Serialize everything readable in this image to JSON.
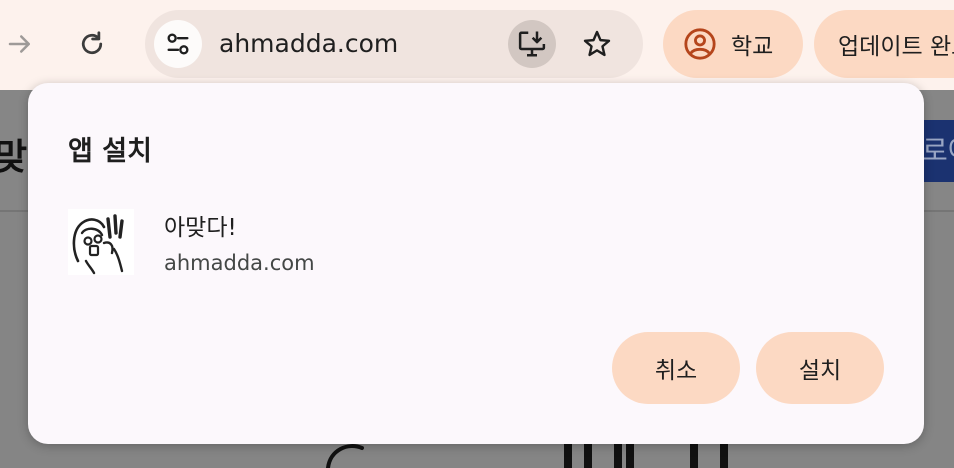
{
  "toolbar": {
    "url": "ahmadda.com",
    "profile_label": "학교",
    "update_label": "업데이트 완료"
  },
  "page": {
    "logo_text": "맞다",
    "header_button_text": "로아"
  },
  "dialog": {
    "title": "앱 설치",
    "app_name": "아맞다!",
    "app_origin": "ahmadda.com",
    "cancel_label": "취소",
    "install_label": "설치"
  },
  "colors": {
    "toolbar_bg": "#fdf2ed",
    "omnibox_bg": "#f0e4df",
    "chip_bg": "#fcd9c3",
    "profile_icon": "#b5451b",
    "dialog_bg": "#fcf8fc",
    "page_dim": "#858585"
  },
  "icons": {
    "forward": "arrow-forward-icon",
    "reload": "reload-icon",
    "site_info": "tune-icon",
    "install": "install-app-icon",
    "bookmark": "star-icon",
    "profile": "account-circle-icon"
  }
}
